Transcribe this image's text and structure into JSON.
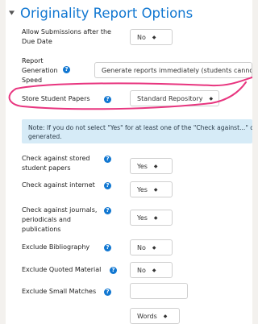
{
  "section": {
    "title": "Originality Report Options"
  },
  "fields": {
    "allow_submissions": {
      "label_line1": "Allow Submissions after the",
      "label_line2": "Due Date",
      "value": "No"
    },
    "report_speed": {
      "label_line1": "Report",
      "label_line2": "Generation",
      "label_line3": "Speed",
      "value": "Generate reports immediately (students cannot re"
    },
    "store_papers": {
      "label": "Store Student Papers",
      "value": "Standard Repository"
    },
    "check_stored": {
      "label_line1": "Check against stored",
      "label_line2": "student papers",
      "value": "Yes"
    },
    "check_internet": {
      "label": "Check against internet",
      "value": "Yes"
    },
    "check_journals": {
      "label_line1": "Check against journals,",
      "label_line2": "periodicals and",
      "label_line3": "publications",
      "value": "Yes"
    },
    "exclude_bibliography": {
      "label": "Exclude Bibliography",
      "value": "No"
    },
    "exclude_quoted": {
      "label": "Exclude Quoted Material",
      "value": "No"
    },
    "exclude_small": {
      "label": "Exclude Small Matches",
      "value": "",
      "unit_value": "Words"
    }
  },
  "note": {
    "line1": "Note: If you do not select \"Yes\" for at least one of the \"Check against...\" optio",
    "line2": "generated."
  },
  "icons": {
    "help": "help-icon",
    "collapse": "caret-down-icon",
    "select_arrow": "up-down-arrows-icon"
  },
  "colors": {
    "accent": "#1177d1",
    "highlight": "#e8357f",
    "note_bg": "#d6ebf7"
  }
}
